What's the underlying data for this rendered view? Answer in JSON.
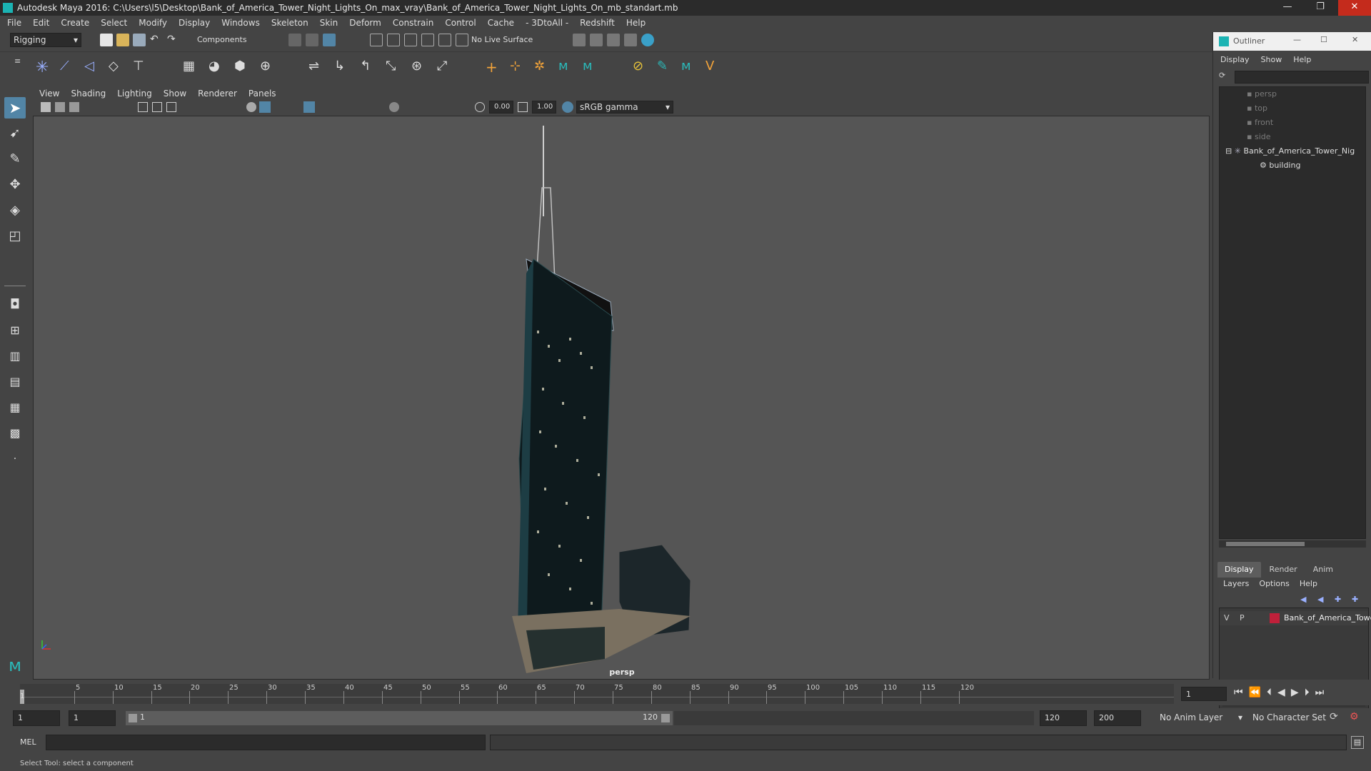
{
  "window": {
    "title": "Autodesk Maya 2016: C:\\Users\\l5\\Desktop\\Bank_of_America_Tower_Night_Lights_On_max_vray\\Bank_of_America_Tower_Night_Lights_On_mb_standart.mb",
    "minimize": "—",
    "maximize": "❐",
    "close": "✕"
  },
  "menubar": [
    "File",
    "Edit",
    "Create",
    "Select",
    "Modify",
    "Display",
    "Windows",
    "Skeleton",
    "Skin",
    "Deform",
    "Constrain",
    "Control",
    "Cache",
    "- 3DtoAll -",
    "Redshift",
    "Help"
  ],
  "statusline": {
    "mode": "Rigging",
    "selection_mode": "Components",
    "live_surface": "No Live Surface"
  },
  "viewport": {
    "menu": [
      "View",
      "Shading",
      "Lighting",
      "Show",
      "Renderer",
      "Panels"
    ],
    "exposure": "0.00",
    "gamma": "1.00",
    "colorspace": "sRGB gamma",
    "camera": "persp"
  },
  "outliner": {
    "title": "Outliner",
    "menu": [
      "Display",
      "Show",
      "Help"
    ],
    "items": [
      {
        "label": "persp"
      },
      {
        "label": "top"
      },
      {
        "label": "front"
      },
      {
        "label": "side"
      },
      {
        "label": "Bank_of_America_Tower_Nig"
      },
      {
        "label": "building"
      }
    ]
  },
  "layers": {
    "tabs": [
      "Display",
      "Render",
      "Anim"
    ],
    "menu": [
      "Layers",
      "Options",
      "Help"
    ],
    "row": {
      "v": "V",
      "p": "P",
      "name": "Bank_of_America_Tower",
      "color": "#c0203a"
    }
  },
  "timeline": {
    "ticks": [
      "5",
      "10",
      "15",
      "20",
      "25",
      "30",
      "35",
      "40",
      "45",
      "50",
      "55",
      "60",
      "65",
      "70",
      "75",
      "80",
      "85",
      "90",
      "95",
      "100",
      "105",
      "110",
      "115",
      "120"
    ],
    "first_tick": "1",
    "current_frame": "1"
  },
  "range": {
    "start": "1",
    "playback_start": "1",
    "slider_start": "1",
    "slider_end": "120",
    "playback_end": "120",
    "end": "200",
    "anim_layer": "No Anim Layer",
    "character_set": "No Character Set"
  },
  "cmdline": {
    "label": "MEL"
  },
  "helpline": {
    "text": "Select Tool: select a component"
  }
}
